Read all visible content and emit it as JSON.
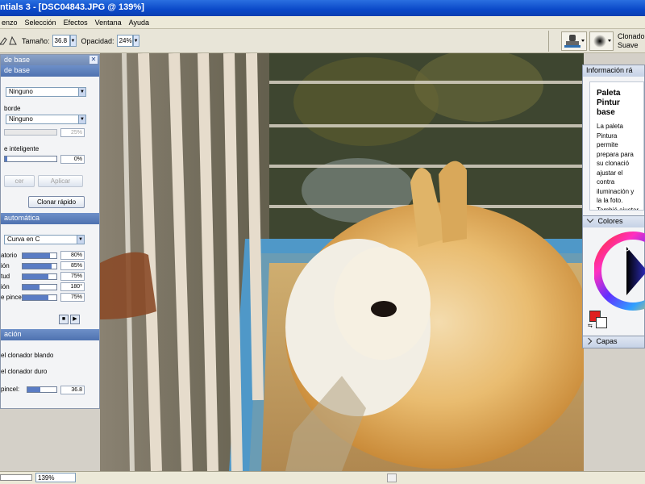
{
  "window": {
    "title": "ntials 3 - [DSC04843.JPG @ 139%]"
  },
  "menu": [
    "enzo",
    "Selección",
    "Efectos",
    "Ventana",
    "Ayuda"
  ],
  "toolbar": {
    "size_label": "Tamaño:",
    "size_value": "36.8",
    "opacity_label": "Opacidad:",
    "opacity_value": "24%",
    "tool_name": "Clonador",
    "tool_mode": "Suave"
  },
  "left_panel": {
    "title": "de base",
    "fill_value": "Ninguno",
    "border_label": "borde",
    "border_value": "Ninguno",
    "border_percent": "25%",
    "smart_label": "e inteligente",
    "smart_value": "0%",
    "cancel_btn": "cer",
    "apply_btn": "Aplicar",
    "quick_clone_btn": "Clonar rápido",
    "auto_section": "automática",
    "curve_value": "Curva en C",
    "params": [
      {
        "label": "atorio",
        "value": "80%",
        "level": 0.8
      },
      {
        "label": "ión",
        "value": "85%",
        "level": 0.85
      },
      {
        "label": "tud",
        "value": "75%",
        "level": 0.75
      },
      {
        "label": "ión",
        "value": "180°",
        "level": 0.5
      },
      {
        "label": "e pincel",
        "value": "75%",
        "level": 0.75
      }
    ],
    "clone_section": "ación",
    "soft_clone": "el clonador blando",
    "hard_clone": "el clonador duro",
    "brush_label": "pincel:",
    "brush_value": "36.8",
    "brush_level": 0.45
  },
  "info_panel": {
    "title": "Información rá",
    "heading": "Paleta Pintur base",
    "body": "La paleta Pintura permite prepara para su clonació ajustar el contra iluminación y la la foto. Tambié ajustar los borde para darle el asp retrato. Si desea"
  },
  "colors_panel": {
    "title": "Colores",
    "primary": "#e02020",
    "secondary": "#ffffff"
  },
  "layers_panel": {
    "title": "Capas"
  },
  "status": {
    "zoom": "139%"
  }
}
